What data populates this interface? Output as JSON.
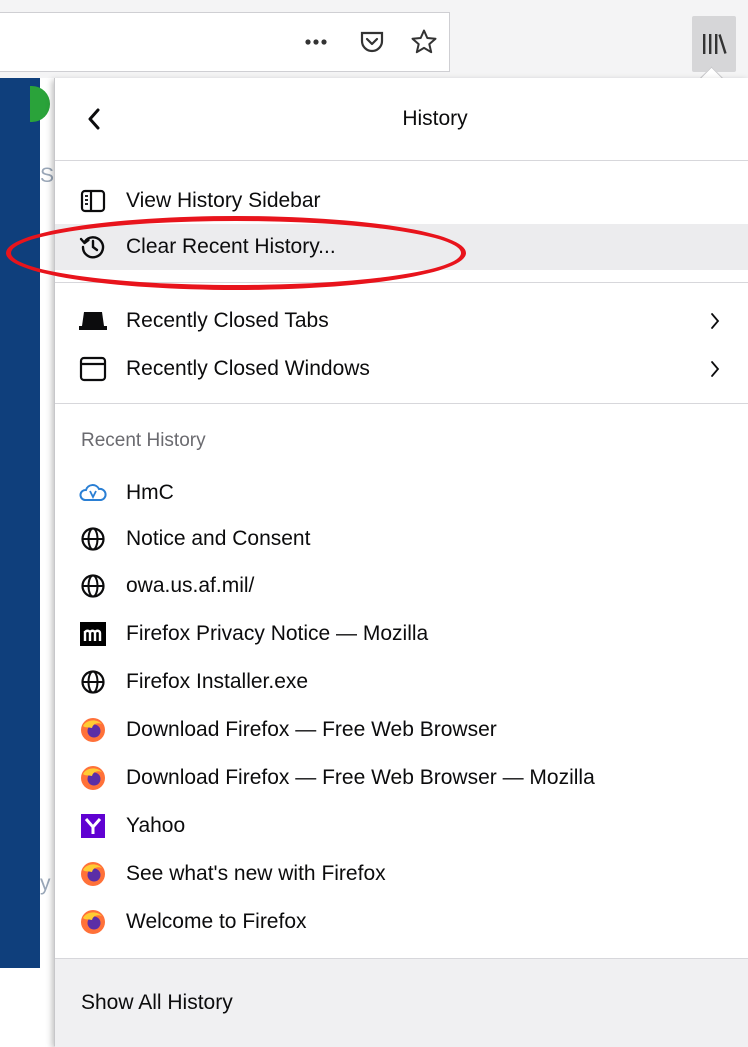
{
  "toolbar": {
    "page_actions_icon": "ellipsis-icon",
    "pocket_icon": "pocket-icon",
    "bookmark_icon": "star-icon",
    "library_icon": "library-icon"
  },
  "page_behind": {
    "fragment_a": "Sc",
    "fragment_b": "y"
  },
  "panel": {
    "title": "History",
    "back_icon": "chevron-left-icon",
    "items_top": [
      {
        "label": "View History Sidebar",
        "icon": "sidebar-icon"
      },
      {
        "label": "Clear Recent History...",
        "icon": "history-icon",
        "highlighted": true
      }
    ],
    "items_closed": [
      {
        "label": "Recently Closed Tabs",
        "icon": "tab-icon"
      },
      {
        "label": "Recently Closed Windows",
        "icon": "window-icon"
      }
    ],
    "recent_label": "Recent History",
    "recent": [
      {
        "label": "HmC",
        "icon": "cloud-icon"
      },
      {
        "label": "Notice and Consent",
        "icon": "globe-icon"
      },
      {
        "label": "owa.us.af.mil/",
        "icon": "globe-icon"
      },
      {
        "label": "Firefox Privacy Notice — Mozilla",
        "icon": "mozilla-icon"
      },
      {
        "label": "Firefox Installer.exe",
        "icon": "globe-icon"
      },
      {
        "label": "Download Firefox — Free Web Browser",
        "icon": "firefox-icon"
      },
      {
        "label": "Download Firefox — Free Web Browser — Mozilla",
        "icon": "firefox-icon"
      },
      {
        "label": "Yahoo",
        "icon": "yahoo-icon"
      },
      {
        "label": "See what's new with Firefox",
        "icon": "firefox-icon"
      },
      {
        "label": "Welcome to Firefox",
        "icon": "firefox-icon"
      }
    ],
    "footer_label": "Show All History"
  },
  "colors": {
    "annotation": "#e8141c",
    "highlight_row": "#ececee",
    "footer_bg": "#f0f0f2",
    "page_strip": "#0f3f7c",
    "firefox_orange": "#ff7139",
    "yahoo_purple": "#6001d2"
  }
}
